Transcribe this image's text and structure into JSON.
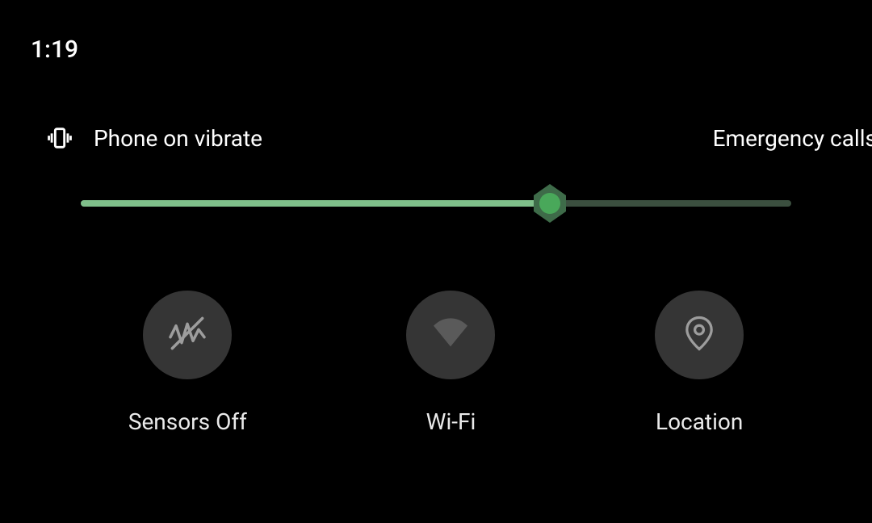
{
  "status": {
    "time": "1:19"
  },
  "header": {
    "ringer_label": "Phone on vibrate",
    "emergency_label": "Emergency calls"
  },
  "brightness": {
    "percent": 66
  },
  "tiles": [
    {
      "id": "sensors-off",
      "label": "Sensors Off",
      "icon": "sensors-off-icon"
    },
    {
      "id": "wifi",
      "label": "Wi-Fi",
      "icon": "wifi-icon"
    },
    {
      "id": "location",
      "label": "Location",
      "icon": "location-icon"
    }
  ],
  "colors": {
    "accent": "#7fbf8a",
    "accent_dark": "#49a85a",
    "track_bg": "#3b4f3f",
    "tile_bg": "#353535",
    "tile_icon": "#9d9d9d"
  }
}
